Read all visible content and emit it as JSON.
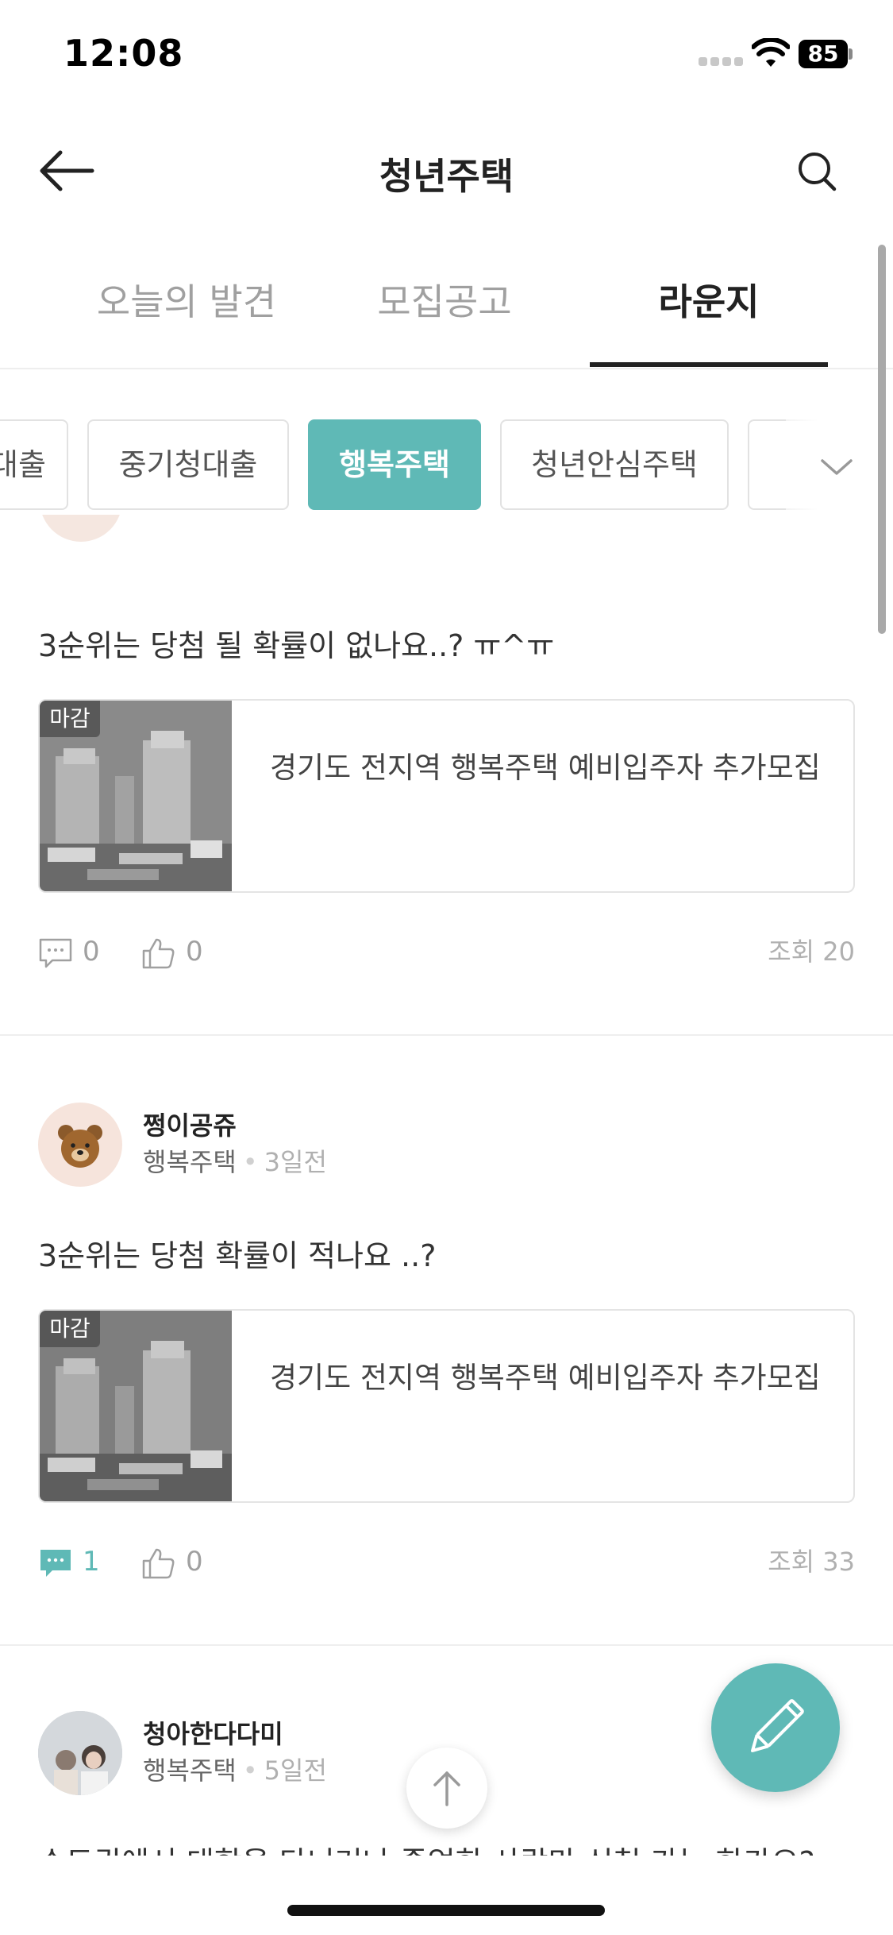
{
  "status_bar": {
    "time": "12:08",
    "battery": "85"
  },
  "nav": {
    "title": "청년주택"
  },
  "tabs": [
    {
      "label": "오늘의 발견",
      "active": false
    },
    {
      "label": "모집공고",
      "active": false
    },
    {
      "label": "라운지",
      "active": true
    }
  ],
  "chips": [
    {
      "label": "대출",
      "active": false
    },
    {
      "label": "중기청대출",
      "active": false
    },
    {
      "label": "행복주택",
      "active": true
    },
    {
      "label": "청년안심주택",
      "active": false
    },
    {
      "label": "",
      "active": false
    }
  ],
  "posts": [
    {
      "body": "3순위는 당첨 될 확률이 없나요..? ㅠ^ㅠ",
      "link_card": {
        "badge": "마감",
        "title": "경기도 전지역 행복주택 예비입주자 추가모집"
      },
      "comments": "0",
      "likes": "0",
      "views": "조회 20"
    },
    {
      "author": "쩡이공쥬",
      "category": "행복주택",
      "time": "3일전",
      "body": "3순위는 당첨 확률이 적나요 ..?",
      "link_card": {
        "badge": "마감",
        "title": "경기도 전지역 행복주택 예비입주자 추가모집"
      },
      "comments": "1",
      "likes": "0",
      "views": "조회 33"
    },
    {
      "author": "청아한다다미",
      "category": "행복주택",
      "time": "5일전",
      "body": "수도권에서 대학을 다니거나 졸업한 사람만 신청 가능 한가요?"
    }
  ],
  "colors": {
    "accent": "#5fb9b6",
    "text": "#222222",
    "muted": "#a0a0a0"
  }
}
